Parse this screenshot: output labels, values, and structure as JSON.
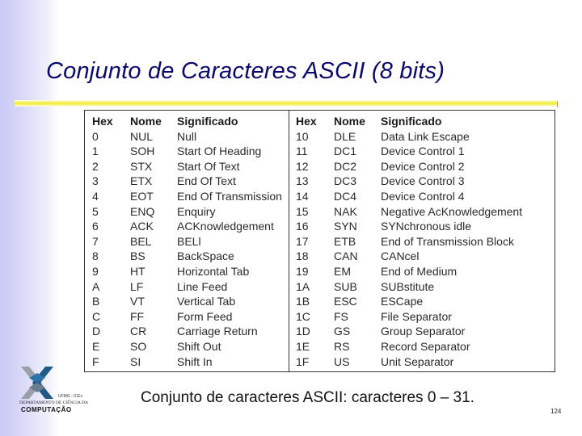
{
  "slide": {
    "title": "Conjunto de Caracteres ASCII (8 bits)",
    "caption": "Conjunto de caracteres ASCII: caracteres 0 – 31.",
    "page_number": "124",
    "colors": {
      "title": "#0a0a6e",
      "accent_rule": "#f3ec3a",
      "side_gradient": "#c8c8f4"
    }
  },
  "table": {
    "headers": [
      "Hex",
      "Nome",
      "Significado"
    ],
    "left_rows": [
      {
        "hex": "0",
        "nome": "NUL",
        "significado": "Null"
      },
      {
        "hex": "1",
        "nome": "SOH",
        "significado": "Start Of Heading"
      },
      {
        "hex": "2",
        "nome": "STX",
        "significado": "Start Of Text"
      },
      {
        "hex": "3",
        "nome": "ETX",
        "significado": "End Of Text"
      },
      {
        "hex": "4",
        "nome": "EOT",
        "significado": "End Of Transmission"
      },
      {
        "hex": "5",
        "nome": "ENQ",
        "significado": "Enquiry"
      },
      {
        "hex": "6",
        "nome": "ACK",
        "significado": "ACKnowledgement"
      },
      {
        "hex": "7",
        "nome": "BEL",
        "significado": "BELl"
      },
      {
        "hex": "8",
        "nome": "BS",
        "significado": "BackSpace"
      },
      {
        "hex": "9",
        "nome": "HT",
        "significado": "Horizontal Tab"
      },
      {
        "hex": "A",
        "nome": "LF",
        "significado": "Line Feed"
      },
      {
        "hex": "B",
        "nome": "VT",
        "significado": "Vertical Tab"
      },
      {
        "hex": "C",
        "nome": "FF",
        "significado": "Form Feed"
      },
      {
        "hex": "D",
        "nome": "CR",
        "significado": "Carriage Return"
      },
      {
        "hex": "E",
        "nome": "SO",
        "significado": "Shift Out"
      },
      {
        "hex": "F",
        "nome": "SI",
        "significado": "Shift In"
      }
    ],
    "right_rows": [
      {
        "hex": "10",
        "nome": "DLE",
        "significado": "Data Link Escape"
      },
      {
        "hex": "11",
        "nome": "DC1",
        "significado": "Device Control 1"
      },
      {
        "hex": "12",
        "nome": "DC2",
        "significado": "Device Control 2"
      },
      {
        "hex": "13",
        "nome": "DC3",
        "significado": "Device Control 3"
      },
      {
        "hex": "14",
        "nome": "DC4",
        "significado": "Device Control 4"
      },
      {
        "hex": "15",
        "nome": "NAK",
        "significado": "Negative AcKnowledgement"
      },
      {
        "hex": "16",
        "nome": "SYN",
        "significado": "SYNchronous idle"
      },
      {
        "hex": "17",
        "nome": "ETB",
        "significado": "End of Transmission Block"
      },
      {
        "hex": "18",
        "nome": "CAN",
        "significado": "CANcel"
      },
      {
        "hex": "19",
        "nome": "EM",
        "significado": "End of Medium"
      },
      {
        "hex": "1A",
        "nome": "SUB",
        "significado": "SUBstitute"
      },
      {
        "hex": "1B",
        "nome": "ESC",
        "significado": "ESCape"
      },
      {
        "hex": "1C",
        "nome": "FS",
        "significado": "File Separator"
      },
      {
        "hex": "1D",
        "nome": "GS",
        "significado": "Group Separator"
      },
      {
        "hex": "1E",
        "nome": "RS",
        "significado": "Record Separator"
      },
      {
        "hex": "1F",
        "nome": "US",
        "significado": "Unit Separator"
      }
    ]
  },
  "logo": {
    "icon": "dcc-logo-icon",
    "line1": "UFMG - ICEx",
    "line2": "DEPARTAMENTO DE CIÊNCIA DA",
    "line3": "COMPUTAÇÃO"
  }
}
